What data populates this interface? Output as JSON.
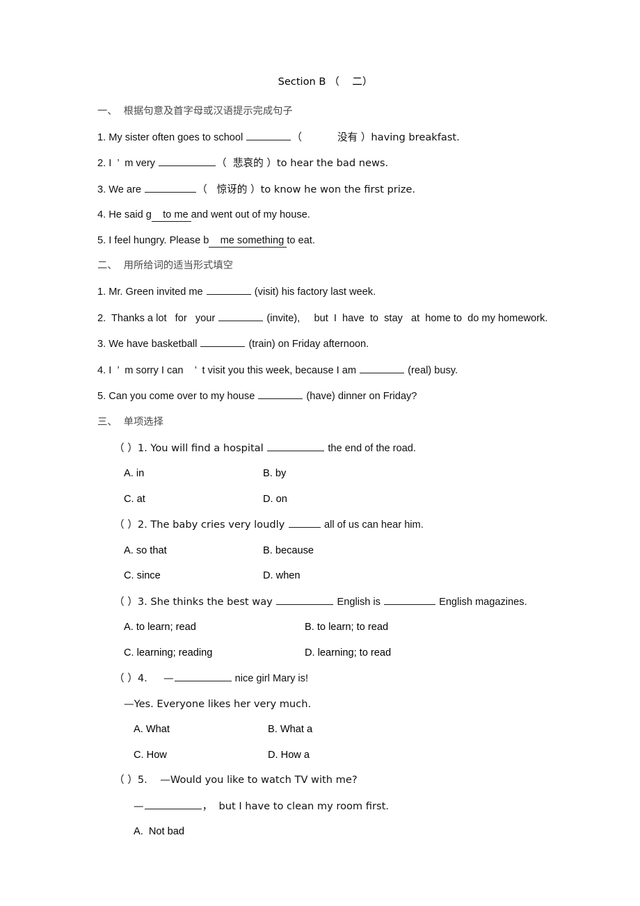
{
  "document": {
    "title": "Section B （    二）",
    "sections": [
      {
        "heading": "一、  根据句意及首字母或汉语提示完成句子",
        "items": [
          {
            "pre": "1. My sister often goes to school ",
            "mid": "（           没有 ）having breakfast."
          },
          {
            "pre": "2. I  ’  m very ",
            "mid": "（  悲哀的 ）to hear the bad news."
          },
          {
            "pre": "3. We are ",
            "mid": "（   惊讶的 ）to know he won the first prize."
          },
          {
            "pre": "4. He said g",
            "mid": "to me ",
            "post": "and went out of my house."
          },
          {
            "pre": "5. I feel hungry. Please b",
            "mid": "me something ",
            "post": "to eat."
          }
        ]
      },
      {
        "heading": "二、  用所给词的适当形式填空",
        "items": [
          {
            "pre": "1. Mr. Green invited me ",
            "post": " (visit) his factory last week."
          },
          {
            "pre": "2.  Thanks a lot   for   your ",
            "post": " (invite),     but  I  have  to  stay   at  home to  do my homework."
          },
          {
            "pre": "3. We have basketball ",
            "post": " (train) on Friday afternoon."
          },
          {
            "pre": "4. I  ’  m sorry I can    ’  t visit you this week, because I am ",
            "post": " (real) busy."
          },
          {
            "pre": "5. Can you come over to my house ",
            "post": " (have) dinner on Friday?"
          }
        ]
      },
      {
        "heading": "三、  单项选择",
        "questions": [
          {
            "stem_pre": "（ ）1. You will find a hospital ",
            "stem_post": " the end of the road.",
            "options": [
              "A. in",
              "B. by",
              "C. at",
              "D. on"
            ]
          },
          {
            "stem_pre": "（ ）2. The baby cries very loudly ",
            "stem_post": " all of us can hear him.",
            "options": [
              "A. so that",
              "B. because",
              "C. since",
              "D. when"
            ]
          },
          {
            "stem_pre": "（ ）3. She thinks the best way ",
            "stem_mid": " English is ",
            "stem_post": " English magazines.",
            "options": [
              "A. to learn; read",
              "B. to learn; to read",
              "C. learning; reading",
              "D. learning; to read"
            ]
          },
          {
            "stem_pre": "（ ）4.     —",
            "stem_post": " nice girl Mary is!",
            "reply": "—Yes. Everyone likes her very much.",
            "options": [
              "A. What",
              "B. What a",
              "C. How",
              "D. How a"
            ]
          },
          {
            "stem_pre": "（ ）5.    —Would you like to watch TV with me?",
            "reply_pre": "—",
            "reply_post": "，  but I have to clean my room first.",
            "options": [
              "A.  Not bad"
            ]
          }
        ]
      }
    ]
  }
}
